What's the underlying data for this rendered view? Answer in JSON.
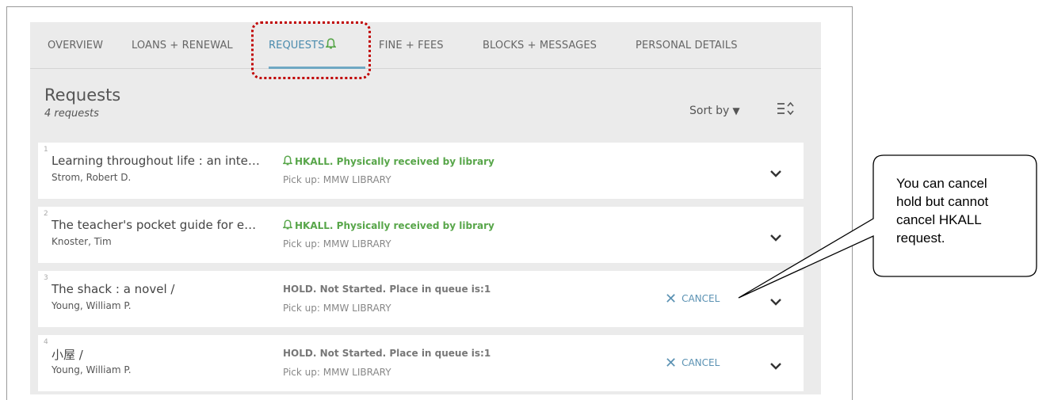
{
  "tabs": [
    {
      "label": "OVERVIEW"
    },
    {
      "label": "LOANS + RENEWAL"
    },
    {
      "label": "REQUESTS"
    },
    {
      "label": "FINE + FEES"
    },
    {
      "label": "BLOCKS + MESSAGES"
    },
    {
      "label": "PERSONAL DETAILS"
    }
  ],
  "active_tab": "REQUESTS",
  "header": {
    "title": "Requests",
    "count": "4 requests",
    "sort_label": "Sort by"
  },
  "items": [
    {
      "index": "1",
      "title": "Learning throughout life : an intergenerational perspective",
      "author": "Strom, Robert D.",
      "status": "HKALL. Physically received by library",
      "pickup": "Pick up: MMW LIBRARY",
      "cancel": ""
    },
    {
      "index": "2",
      "title": "The teacher's pocket guide for effective classroom management",
      "author": "Knoster, Tim",
      "status": "HKALL. Physically received by library",
      "pickup": "Pick up: MMW LIBRARY",
      "cancel": ""
    },
    {
      "index": "3",
      "title": "The shack : a novel /",
      "author": "Young, William P.",
      "status": "HOLD. Not Started. Place in queue is:1",
      "pickup": "Pick up: MMW LIBRARY",
      "cancel": "CANCEL"
    },
    {
      "index": "4",
      "title": "小屋 /",
      "author": "Young, William P.",
      "status": "HOLD. Not Started. Place in queue is:1",
      "pickup": "Pick up: MMW LIBRARY",
      "cancel": "CANCEL"
    }
  ],
  "callout": {
    "lines": [
      "You can cancel",
      "hold but cannot",
      "cancel HKALL",
      "request."
    ]
  },
  "colors": {
    "accent": "#5b92b3",
    "active_underline": "#6fa8c3",
    "hkall_green": "#58a64a",
    "highlight_red": "#c00000",
    "panel_bg": "#ebebeb"
  },
  "icons": {
    "requests_tab": "bell-icon",
    "hkall_status": "bell-icon",
    "cancel": "close-icon",
    "expand": "chevron-down-icon",
    "sort": "sort-toggle-icon"
  }
}
